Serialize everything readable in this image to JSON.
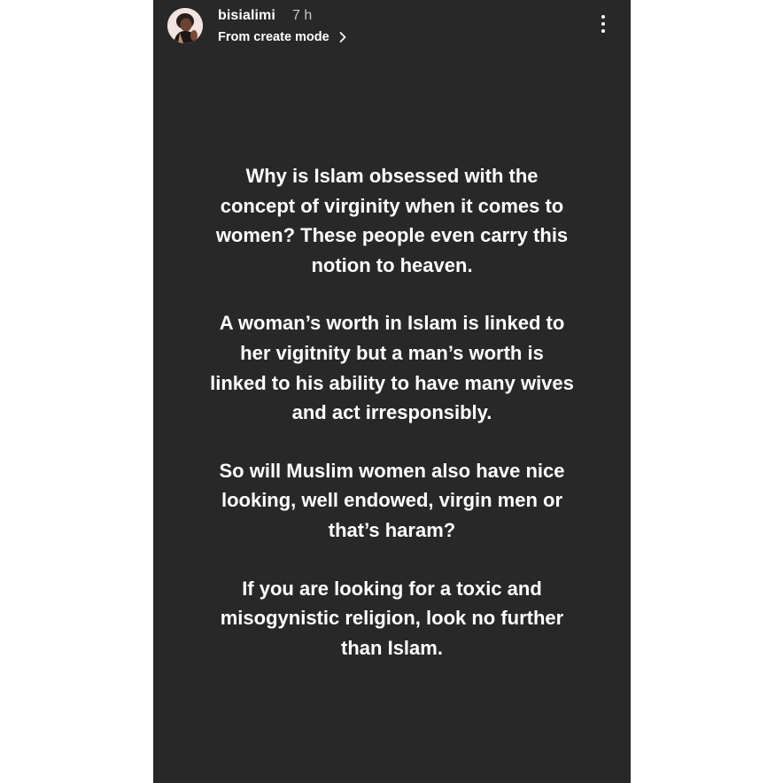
{
  "story": {
    "username": "bisialimi",
    "time": "7 h",
    "subtitle": "From create mode",
    "paragraphs": [
      {
        "lines": [
          "Why is Islam obsessed with the",
          "concept of virginity when it comes to",
          "women? These people even carry this",
          "notion to heaven."
        ]
      },
      {
        "lines": [
          "A woman’s worth in Islam is linked to",
          "her vigitnity but a man’s worth is",
          "linked to his ability to have many wives",
          "and act irresponsibly."
        ]
      },
      {
        "lines": [
          "So will Muslim women also have nice",
          "looking, well endowed, virgin men or",
          "that’s haram?"
        ]
      },
      {
        "lines": [
          "If you are looking for a toxic and",
          "misogynistic religion, look no further",
          "than Islam."
        ]
      }
    ]
  },
  "icons": {
    "avatar": "profile-photo",
    "subtitle_chevron": "chevron-right-icon",
    "menu": "more-vertical-icon"
  },
  "colors": {
    "background": "#282828",
    "page": "#ffffff",
    "text": "#ffffff",
    "muted": "#c9c9c9"
  }
}
